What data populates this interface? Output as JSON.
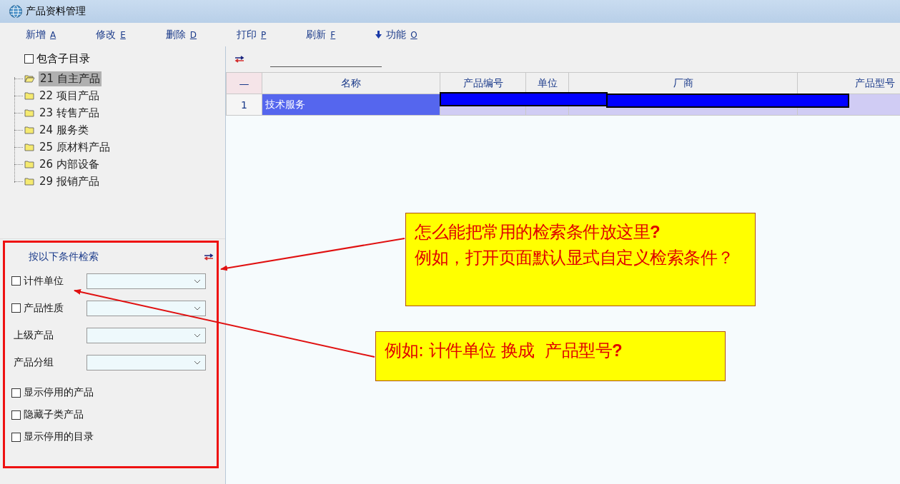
{
  "window": {
    "title": "产品资料管理"
  },
  "toolbar": [
    {
      "label": "新增",
      "hotkey": "A",
      "kind": "plain"
    },
    {
      "label": "修改",
      "hotkey": "E",
      "kind": "plain"
    },
    {
      "label": "删除",
      "hotkey": "D",
      "kind": "plain"
    },
    {
      "label": "打印",
      "hotkey": "P",
      "kind": "plain"
    },
    {
      "label": "刷新",
      "hotkey": "F",
      "kind": "plain"
    },
    {
      "label": "功能",
      "hotkey": "O",
      "kind": "menu"
    }
  ],
  "tree": {
    "include_subdirs": {
      "label": "包含子目录",
      "checked": false
    },
    "items": [
      {
        "label": "21 自主产品",
        "selected": true
      },
      {
        "label": "22 项目产品",
        "selected": false
      },
      {
        "label": "23 转售产品",
        "selected": false
      },
      {
        "label": "24 服务类",
        "selected": false
      },
      {
        "label": "25 原材料产品",
        "selected": false
      },
      {
        "label": "26 内部设备",
        "selected": false
      },
      {
        "label": "29 报销产品",
        "selected": false
      }
    ]
  },
  "search": {
    "title": "按以下条件检索",
    "fields": [
      {
        "kind": "check-select",
        "label": "计件单位",
        "checked": false
      },
      {
        "kind": "check-select",
        "label": "产品性质",
        "checked": false
      },
      {
        "kind": "select",
        "label": "上级产品"
      },
      {
        "kind": "select",
        "label": "产品分组"
      }
    ],
    "options": [
      {
        "label": "显示停用的产品",
        "checked": false
      },
      {
        "label": "隐藏子类产品",
        "checked": false
      },
      {
        "label": "显示停用的目录",
        "checked": false
      }
    ]
  },
  "grid": {
    "columns": [
      "—",
      "名称",
      "产品编号",
      "单位",
      "厂商",
      "产品型号"
    ],
    "rows": [
      {
        "cells": [
          "1",
          "技术服务"
        ],
        "selected": true
      }
    ]
  },
  "annotations": [
    {
      "text": "怎么能把常用的检索条件放这里**?**\n例如，打开页面默认显式自定义检索条件？"
    },
    {
      "text": "例如: 计件单位 换成  产品型号**?**"
    }
  ]
}
